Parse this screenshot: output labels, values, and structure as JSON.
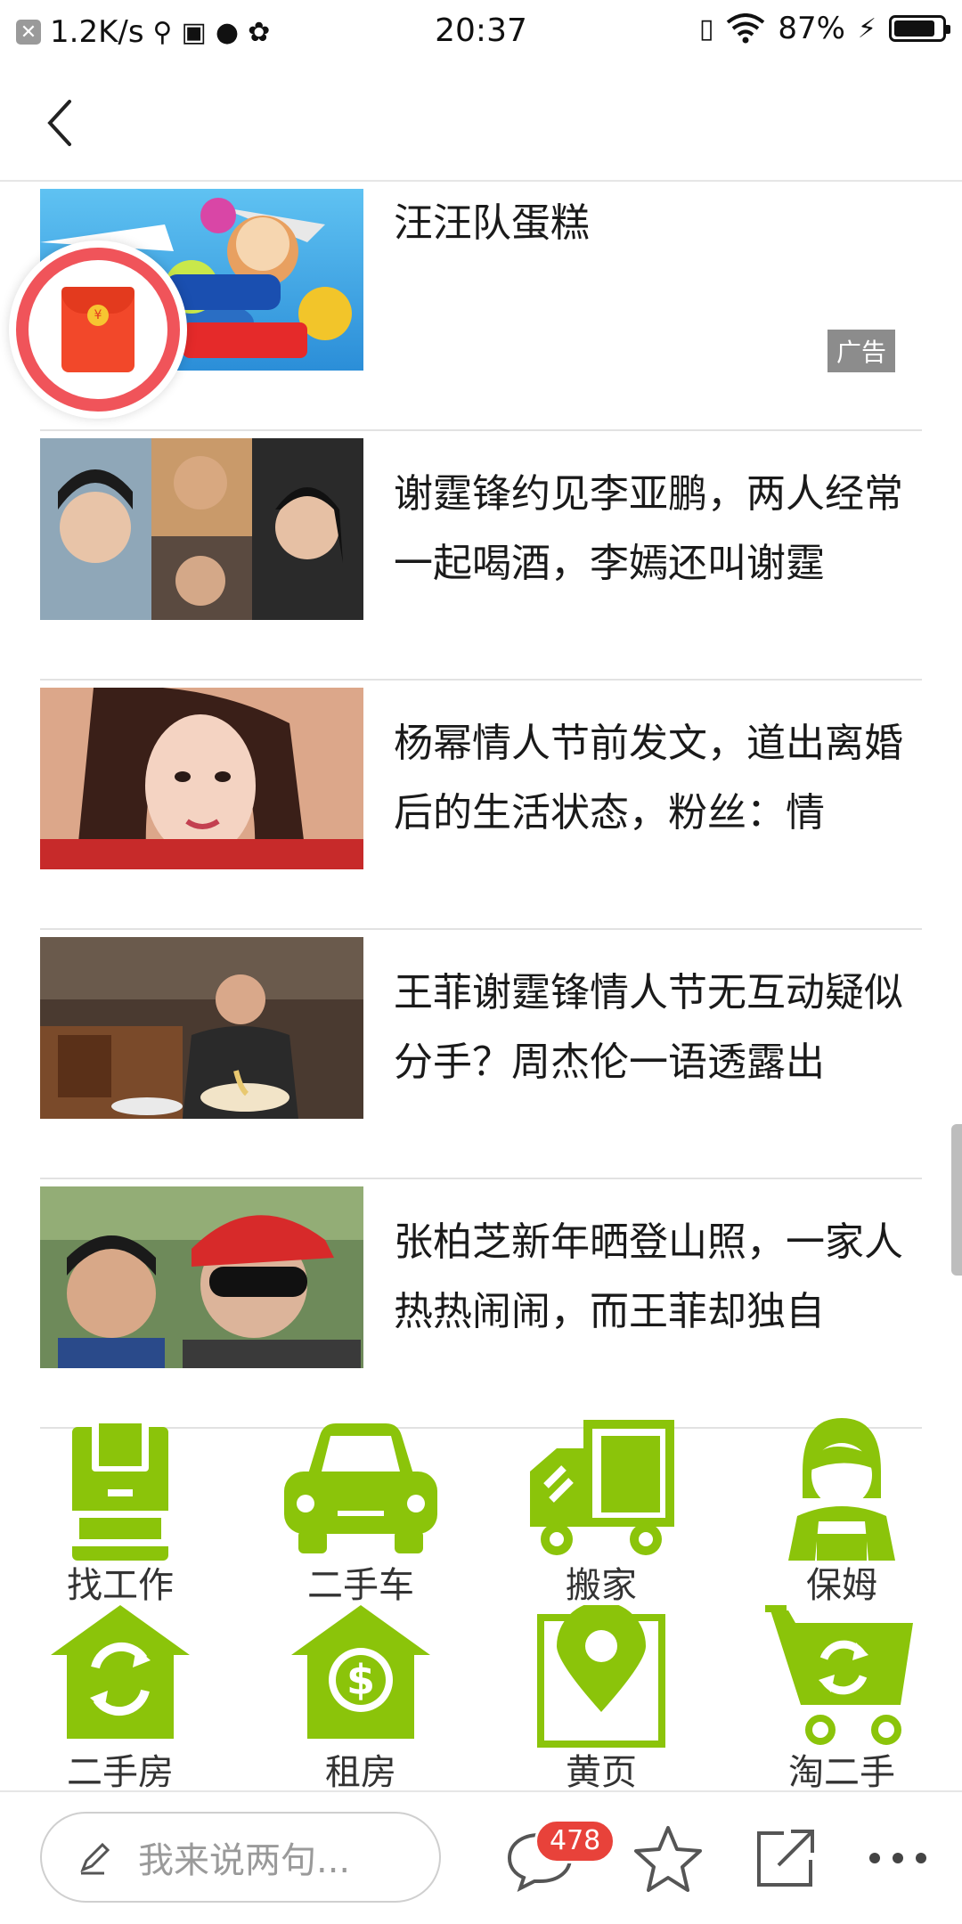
{
  "status_bar": {
    "net_speed": "1.2K/s",
    "time": "20:37",
    "battery": "87%",
    "battery_level": 0.87
  },
  "header": {
    "back_icon": "chevron-left-icon"
  },
  "news": [
    {
      "title": "汪汪队蛋糕",
      "ad": true,
      "ad_label": "广告"
    },
    {
      "title": "谢霆锋约见李亚鹏，两人经常一起喝酒，李嫣还叫谢霆"
    },
    {
      "title": "杨幂情人节前发文，道出离婚后的生活状态，粉丝：情"
    },
    {
      "title": "王菲谢霆锋情人节无互动疑似分手？周杰伦一语透露出"
    },
    {
      "title": "张柏芝新年晒登山照，一家人热热闹闹，而王菲却独自"
    }
  ],
  "services": [
    {
      "label": "找工作",
      "icon": "job-bag-icon"
    },
    {
      "label": "二手车",
      "icon": "car-icon"
    },
    {
      "label": "搬家",
      "icon": "truck-icon"
    },
    {
      "label": "保姆",
      "icon": "nanny-icon"
    },
    {
      "label": "二手房",
      "icon": "house-refresh-icon"
    },
    {
      "label": "租房",
      "icon": "house-dollar-icon"
    },
    {
      "label": "黄页",
      "icon": "location-pin-icon"
    },
    {
      "label": "淘二手",
      "icon": "cart-refresh-icon"
    }
  ],
  "bottom_bar": {
    "comment_placeholder": "我来说两句...",
    "comment_count": "478"
  },
  "colors": {
    "service_green": "#8bc40a",
    "badge_red": "#e8423a",
    "redpacket_ring": "#f0545a"
  }
}
